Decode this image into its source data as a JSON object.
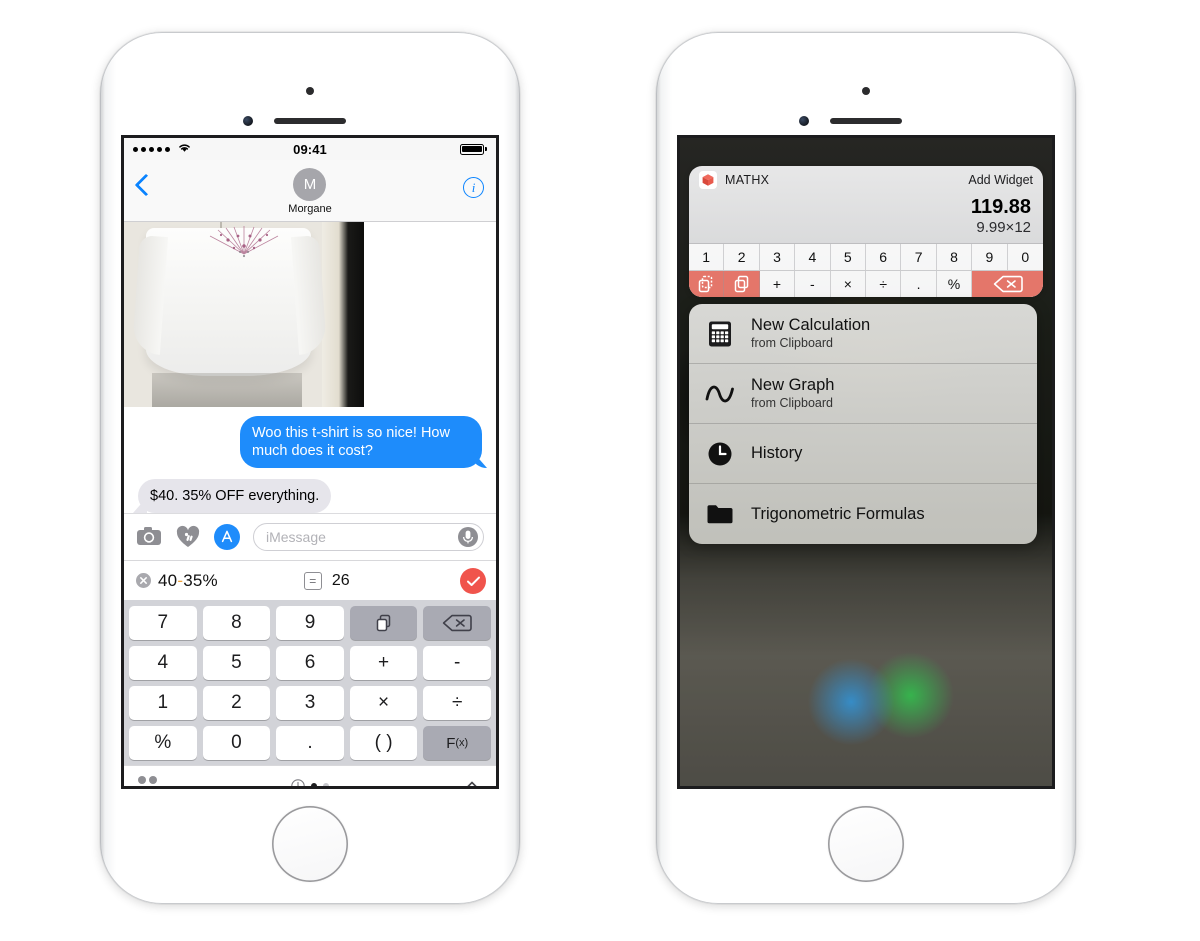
{
  "phone_left": {
    "status_bar": {
      "signal_dots": 5,
      "wifi": "wifi-icon",
      "time": "09:41",
      "battery": "battery-full-icon"
    },
    "nav": {
      "back": "back-chevron-icon",
      "avatar_initial": "M",
      "contact_name": "Morgane",
      "info": "i"
    },
    "conversation": {
      "photo_alt": "white t-shirt with floral embroidery hanging",
      "messages": [
        {
          "from": "me",
          "text": "Woo this t-shirt is so nice! How much does it cost?"
        },
        {
          "from": "them",
          "text": "$40. 35% OFF everything."
        }
      ]
    },
    "input_bar": {
      "camera_icon": "camera-icon",
      "digital_touch_icon": "heart-hand-icon",
      "appstore_icon": "appstore-icon",
      "placeholder": "iMessage",
      "mic_icon": "microphone-icon"
    },
    "calc_row": {
      "clear_icon": "clear-circle-x-icon",
      "expression_a": "40",
      "expression_op": "-",
      "expression_b": "35%",
      "equals_icon": "=",
      "result": "26",
      "send_icon": "checkmark-send-icon"
    },
    "keypad": [
      {
        "label": "7",
        "style": "white"
      },
      {
        "label": "8",
        "style": "white"
      },
      {
        "label": "9",
        "style": "white"
      },
      {
        "label": "copy-icon",
        "style": "grey"
      },
      {
        "label": "delete-icon",
        "style": "grey"
      },
      {
        "label": "4",
        "style": "white"
      },
      {
        "label": "5",
        "style": "white"
      },
      {
        "label": "6",
        "style": "white"
      },
      {
        "label": "+",
        "style": "white"
      },
      {
        "label": "-",
        "style": "white"
      },
      {
        "label": "1",
        "style": "white"
      },
      {
        "label": "2",
        "style": "white"
      },
      {
        "label": "3",
        "style": "white"
      },
      {
        "label": "×",
        "style": "white"
      },
      {
        "label": "÷",
        "style": "white"
      },
      {
        "label": "%",
        "style": "white"
      },
      {
        "label": "0",
        "style": "white"
      },
      {
        "label": ".",
        "style": "white"
      },
      {
        "label": "( )",
        "style": "white"
      },
      {
        "label": "F(x)",
        "style": "grey"
      }
    ],
    "drawer_bar": {
      "grid_icon": "app-grid-icon",
      "recents_icon": "clock-icon",
      "page_dots": 2,
      "active_dot": 0,
      "expand_icon": "chevron-up-icon"
    }
  },
  "phone_right": {
    "widget": {
      "app_icon": "mathx-cube-icon",
      "app_name": "MATHX",
      "add_widget_label": "Add Widget",
      "result": "119.88",
      "expression": "9.99×12",
      "number_keys": [
        "1",
        "2",
        "3",
        "4",
        "5",
        "6",
        "7",
        "8",
        "9",
        "0"
      ],
      "operator_keys": [
        {
          "label": "copy-outline-icon",
          "style": "red"
        },
        {
          "label": "paste-icon",
          "style": "red"
        },
        {
          "label": "+",
          "style": "white"
        },
        {
          "label": "-",
          "style": "white"
        },
        {
          "label": "×",
          "style": "white"
        },
        {
          "label": "÷",
          "style": "white"
        },
        {
          "label": ".",
          "style": "white"
        },
        {
          "label": "%",
          "style": "white"
        },
        {
          "label": "delete-icon",
          "style": "red"
        }
      ]
    },
    "quick_actions": [
      {
        "icon": "calculator-icon",
        "title": "New Calculation",
        "subtitle": "from Clipboard"
      },
      {
        "icon": "sine-wave-icon",
        "title": "New Graph",
        "subtitle": "from Clipboard"
      },
      {
        "icon": "clock-icon",
        "title": "History",
        "subtitle": ""
      },
      {
        "icon": "folder-icon",
        "title": "Trigonometric Formulas",
        "subtitle": ""
      }
    ]
  },
  "colors": {
    "imessage_blue": "#1e8cfb",
    "bubble_grey": "#e6e5eb",
    "accent_red": "#f0544c",
    "widget_red": "#e4766a",
    "operator_orange": "#f0a33c",
    "key_grey": "#a9aab3",
    "keypad_bg": "#d2d3d8"
  }
}
